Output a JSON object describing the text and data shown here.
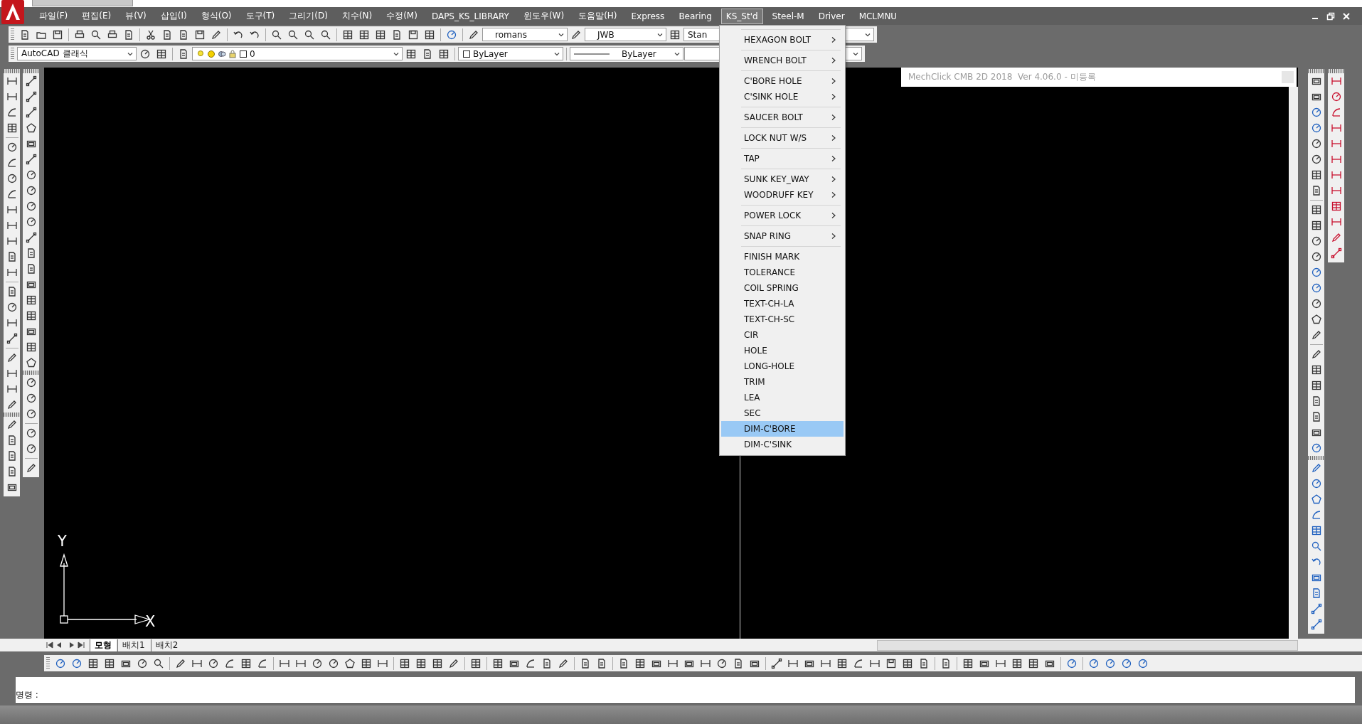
{
  "menu_bar": {
    "items": [
      {
        "label": "파일(F)",
        "selected": false
      },
      {
        "label": "편집(E)",
        "selected": false
      },
      {
        "label": "뷰(V)",
        "selected": false
      },
      {
        "label": "삽입(I)",
        "selected": false
      },
      {
        "label": "형식(O)",
        "selected": false
      },
      {
        "label": "도구(T)",
        "selected": false
      },
      {
        "label": "그리기(D)",
        "selected": false
      },
      {
        "label": "치수(N)",
        "selected": false
      },
      {
        "label": "수정(M)",
        "selected": false
      },
      {
        "label": "DAPS_KS_LIBRARY",
        "selected": false
      },
      {
        "label": "윈도우(W)",
        "selected": false
      },
      {
        "label": "도움말(H)",
        "selected": false
      },
      {
        "label": "Express",
        "selected": false
      },
      {
        "label": "Bearing",
        "selected": false
      },
      {
        "label": "KS_St'd",
        "selected": true
      },
      {
        "label": "Steel-M",
        "selected": false
      },
      {
        "label": "Driver",
        "selected": false
      },
      {
        "label": "MCLMNU",
        "selected": false
      }
    ]
  },
  "toolbar_1": {
    "text_style": "romans",
    "dim_style": "JWB",
    "table_style": "Stan"
  },
  "toolbar_2": {
    "workspace": "AutoCAD 클래식",
    "layer": "0",
    "object_color_setting": "ByLayer",
    "linetype": "ByLayer"
  },
  "dropdown_menu": {
    "items": [
      {
        "label": "HEXAGON BOLT",
        "submenu": true,
        "separator_before": true,
        "selected": false
      },
      {
        "label": "WRENCH BOLT",
        "submenu": true,
        "separator_before": true,
        "selected": false
      },
      {
        "label": "C'BORE HOLE",
        "submenu": true,
        "separator_before": true,
        "selected": false
      },
      {
        "label": "C'SINK HOLE",
        "submenu": true,
        "separator_before": false,
        "selected": false
      },
      {
        "label": "SAUCER BOLT",
        "submenu": true,
        "separator_before": true,
        "selected": false
      },
      {
        "label": "LOCK NUT W/S",
        "submenu": true,
        "separator_before": true,
        "selected": false
      },
      {
        "label": "TAP",
        "submenu": true,
        "separator_before": true,
        "selected": false
      },
      {
        "label": "SUNK KEY_WAY",
        "submenu": true,
        "separator_before": true,
        "selected": false
      },
      {
        "label": "WOODRUFF KEY",
        "submenu": true,
        "separator_before": false,
        "selected": false
      },
      {
        "label": "POWER LOCK",
        "submenu": true,
        "separator_before": true,
        "selected": false
      },
      {
        "label": "SNAP RING",
        "submenu": true,
        "separator_before": true,
        "selected": false
      },
      {
        "label": "FINISH MARK",
        "submenu": false,
        "separator_before": true,
        "selected": false
      },
      {
        "label": "TOLERANCE",
        "submenu": false,
        "separator_before": false,
        "selected": false
      },
      {
        "label": "COIL SPRING",
        "submenu": false,
        "separator_before": false,
        "selected": false
      },
      {
        "label": "TEXT-CH-LA",
        "submenu": false,
        "separator_before": false,
        "selected": false
      },
      {
        "label": "TEXT-CH-SC",
        "submenu": false,
        "separator_before": false,
        "selected": false
      },
      {
        "label": "CIR",
        "submenu": false,
        "separator_before": false,
        "selected": false
      },
      {
        "label": "HOLE",
        "submenu": false,
        "separator_before": false,
        "selected": false
      },
      {
        "label": "LONG-HOLE",
        "submenu": false,
        "separator_before": false,
        "selected": false
      },
      {
        "label": "TRIM",
        "submenu": false,
        "separator_before": false,
        "selected": false
      },
      {
        "label": "LEA",
        "submenu": false,
        "separator_before": false,
        "selected": false
      },
      {
        "label": "SEC",
        "submenu": false,
        "separator_before": false,
        "selected": false
      },
      {
        "label": "DIM-C'BORE",
        "submenu": false,
        "separator_before": false,
        "selected": true
      },
      {
        "label": "DIM-C'SINK",
        "submenu": false,
        "separator_before": false,
        "selected": false
      }
    ]
  },
  "floating_window": {
    "title": "MechClick CMB 2D 2018  Ver 4.06.0 - 미등록"
  },
  "ucs": {
    "y_label": "Y",
    "x_label": "X"
  },
  "layout_tabs": [
    {
      "label": "모형",
      "selected": true
    },
    {
      "label": "배치1",
      "selected": false
    },
    {
      "label": "배치2",
      "selected": false
    }
  ],
  "command_line": {
    "prompt": "명령 :"
  }
}
